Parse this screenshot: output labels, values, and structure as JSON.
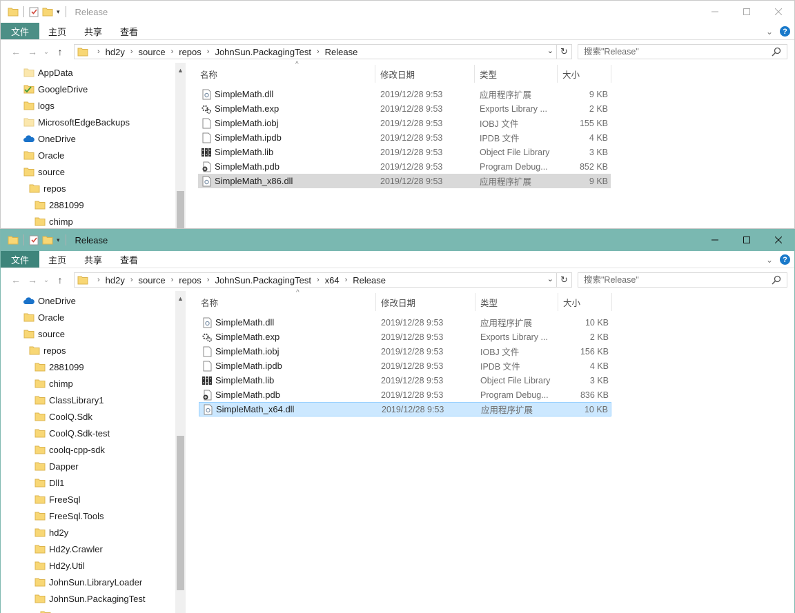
{
  "window_a": {
    "title": "Release",
    "ribbon": {
      "file": "文件",
      "home": "主页",
      "share": "共享",
      "view": "查看"
    },
    "breadcrumb": [
      "hd2y",
      "source",
      "repos",
      "JohnSun.PackagingTest",
      "Release"
    ],
    "search_placeholder": "搜索\"Release\"",
    "columns": {
      "name": "名称",
      "date": "修改日期",
      "type": "类型",
      "size": "大小"
    },
    "tree": [
      {
        "label": "AppData",
        "icon": "folder-faded-icon"
      },
      {
        "label": "GoogleDrive",
        "icon": "folder-sync-check-icon"
      },
      {
        "label": "logs",
        "icon": "folder-icon"
      },
      {
        "label": "MicrosoftEdgeBackups",
        "icon": "folder-faded-icon"
      },
      {
        "label": "OneDrive",
        "icon": "onedrive-cloud-icon"
      },
      {
        "label": "Oracle",
        "icon": "folder-icon"
      },
      {
        "label": "source",
        "icon": "folder-icon"
      },
      {
        "label": "repos",
        "icon": "folder-icon"
      },
      {
        "label": "2881099",
        "icon": "folder-icon"
      },
      {
        "label": "chimp",
        "icon": "folder-icon"
      }
    ],
    "files": [
      {
        "name": "SimpleMath.dll",
        "date": "2019/12/28 9:53",
        "type": "应用程序扩展",
        "size": "9 KB",
        "icon": "dll-file-icon"
      },
      {
        "name": "SimpleMath.exp",
        "date": "2019/12/28 9:53",
        "type": "Exports Library ...",
        "size": "2 KB",
        "icon": "exp-file-icon"
      },
      {
        "name": "SimpleMath.iobj",
        "date": "2019/12/28 9:53",
        "type": "IOBJ 文件",
        "size": "155 KB",
        "icon": "blank-file-icon"
      },
      {
        "name": "SimpleMath.ipdb",
        "date": "2019/12/28 9:53",
        "type": "IPDB 文件",
        "size": "4 KB",
        "icon": "blank-file-icon"
      },
      {
        "name": "SimpleMath.lib",
        "date": "2019/12/28 9:53",
        "type": "Object File Library",
        "size": "3 KB",
        "icon": "lib-file-icon"
      },
      {
        "name": "SimpleMath.pdb",
        "date": "2019/12/28 9:53",
        "type": "Program Debug...",
        "size": "852 KB",
        "icon": "pdb-file-icon"
      },
      {
        "name": "SimpleMath_x86.dll",
        "date": "2019/12/28 9:53",
        "type": "应用程序扩展",
        "size": "9 KB",
        "icon": "dll-file-icon",
        "selected": "inactive"
      }
    ]
  },
  "window_b": {
    "title": "Release",
    "ribbon": {
      "file": "文件",
      "home": "主页",
      "share": "共享",
      "view": "查看"
    },
    "breadcrumb": [
      "hd2y",
      "source",
      "repos",
      "JohnSun.PackagingTest",
      "x64",
      "Release"
    ],
    "search_placeholder": "搜索\"Release\"",
    "columns": {
      "name": "名称",
      "date": "修改日期",
      "type": "类型",
      "size": "大小"
    },
    "tree": [
      {
        "label": "OneDrive",
        "icon": "onedrive-cloud-icon"
      },
      {
        "label": "Oracle",
        "icon": "folder-icon"
      },
      {
        "label": "source",
        "icon": "folder-icon"
      },
      {
        "label": "repos",
        "icon": "folder-icon"
      },
      {
        "label": "2881099",
        "icon": "folder-icon"
      },
      {
        "label": "chimp",
        "icon": "folder-icon"
      },
      {
        "label": "ClassLibrary1",
        "icon": "folder-icon"
      },
      {
        "label": "CoolQ.Sdk",
        "icon": "folder-icon"
      },
      {
        "label": "CoolQ.Sdk-test",
        "icon": "folder-icon"
      },
      {
        "label": "coolq-cpp-sdk",
        "icon": "folder-icon"
      },
      {
        "label": "Dapper",
        "icon": "folder-icon"
      },
      {
        "label": "Dll1",
        "icon": "folder-icon"
      },
      {
        "label": "FreeSql",
        "icon": "folder-icon"
      },
      {
        "label": "FreeSql.Tools",
        "icon": "folder-icon"
      },
      {
        "label": "hd2y",
        "icon": "folder-icon"
      },
      {
        "label": "Hd2y.Crawler",
        "icon": "folder-icon"
      },
      {
        "label": "Hd2y.Util",
        "icon": "folder-icon"
      },
      {
        "label": "JohnSun.LibraryLoader",
        "icon": "folder-icon"
      },
      {
        "label": "JohnSun.PackagingTest",
        "icon": "folder-icon"
      }
    ],
    "files": [
      {
        "name": "SimpleMath.dll",
        "date": "2019/12/28 9:53",
        "type": "应用程序扩展",
        "size": "10 KB",
        "icon": "dll-file-icon"
      },
      {
        "name": "SimpleMath.exp",
        "date": "2019/12/28 9:53",
        "type": "Exports Library ...",
        "size": "2 KB",
        "icon": "exp-file-icon"
      },
      {
        "name": "SimpleMath.iobj",
        "date": "2019/12/28 9:53",
        "type": "IOBJ 文件",
        "size": "156 KB",
        "icon": "blank-file-icon"
      },
      {
        "name": "SimpleMath.ipdb",
        "date": "2019/12/28 9:53",
        "type": "IPDB 文件",
        "size": "4 KB",
        "icon": "blank-file-icon"
      },
      {
        "name": "SimpleMath.lib",
        "date": "2019/12/28 9:53",
        "type": "Object File Library",
        "size": "3 KB",
        "icon": "lib-file-icon"
      },
      {
        "name": "SimpleMath.pdb",
        "date": "2019/12/28 9:53",
        "type": "Program Debug...",
        "size": "836 KB",
        "icon": "pdb-file-icon"
      },
      {
        "name": "SimpleMath_x64.dll",
        "date": "2019/12/28 9:53",
        "type": "应用程序扩展",
        "size": "10 KB",
        "icon": "dll-file-icon",
        "selected": "active"
      }
    ]
  },
  "colors": {
    "accent_titlebar_active": "#7ab8b1",
    "ribbon_file_tab": "#3e857b",
    "selection_active": "#cce8ff",
    "selection_inactive": "#d9d9d9",
    "folder_yellow": "#f8d775"
  }
}
